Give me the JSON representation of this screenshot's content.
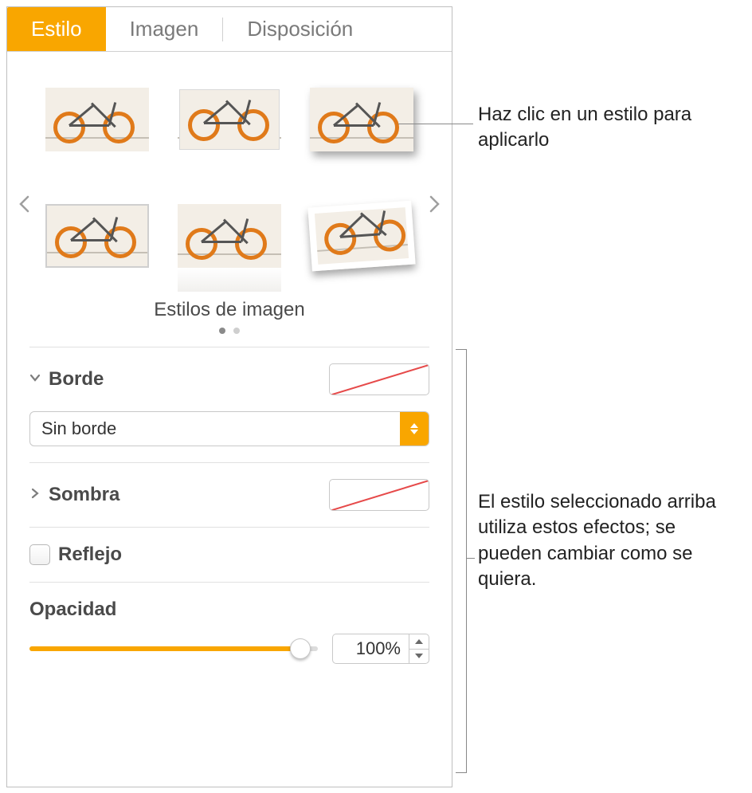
{
  "tabs": {
    "style": "Estilo",
    "image": "Imagen",
    "arrange": "Disposición"
  },
  "styles": {
    "caption": "Estilos de imagen"
  },
  "border": {
    "title": "Borde",
    "select_value": "Sin borde"
  },
  "shadow": {
    "title": "Sombra"
  },
  "reflection": {
    "title": "Reflejo"
  },
  "opacity": {
    "title": "Opacidad",
    "value": "100%"
  },
  "callouts": {
    "styles": "Haz clic en un estilo para aplicarlo",
    "effects": "El estilo seleccionado arriba utiliza estos efectos; se pueden cambiar como se quiera."
  }
}
